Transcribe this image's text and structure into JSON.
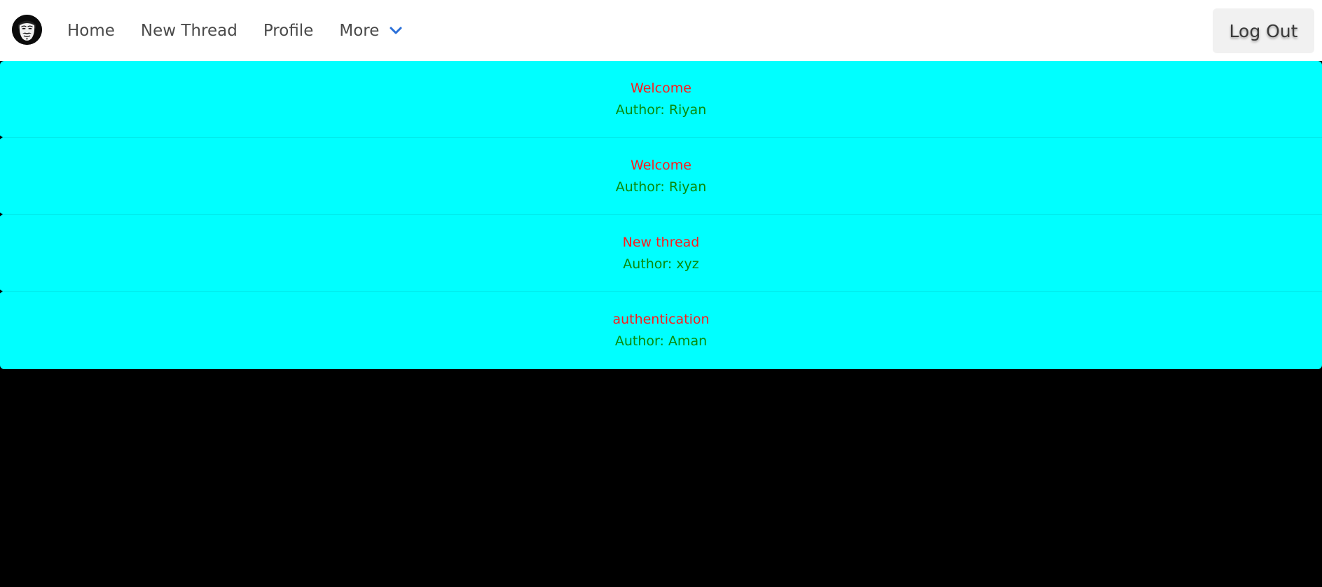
{
  "nav": {
    "logo_icon": "anonymous-mask-icon",
    "links": [
      {
        "label": "Home"
      },
      {
        "label": "New Thread"
      },
      {
        "label": "Profile"
      }
    ],
    "more_label": "More",
    "more_icon": "chevron-down-icon",
    "logout_label": "Log Out"
  },
  "colors": {
    "thread_background": "#00ffff",
    "title_color": "#ff1a1a",
    "author_color": "#0a8a0a",
    "chevron_color": "#2a6fd8"
  },
  "threads": [
    {
      "title": "Welcome",
      "author": "Author: Riyan"
    },
    {
      "title": "Welcome",
      "author": "Author: Riyan"
    },
    {
      "title": "New thread",
      "author": "Author: xyz"
    },
    {
      "title": "authentication",
      "author": "Author: Aman"
    }
  ]
}
